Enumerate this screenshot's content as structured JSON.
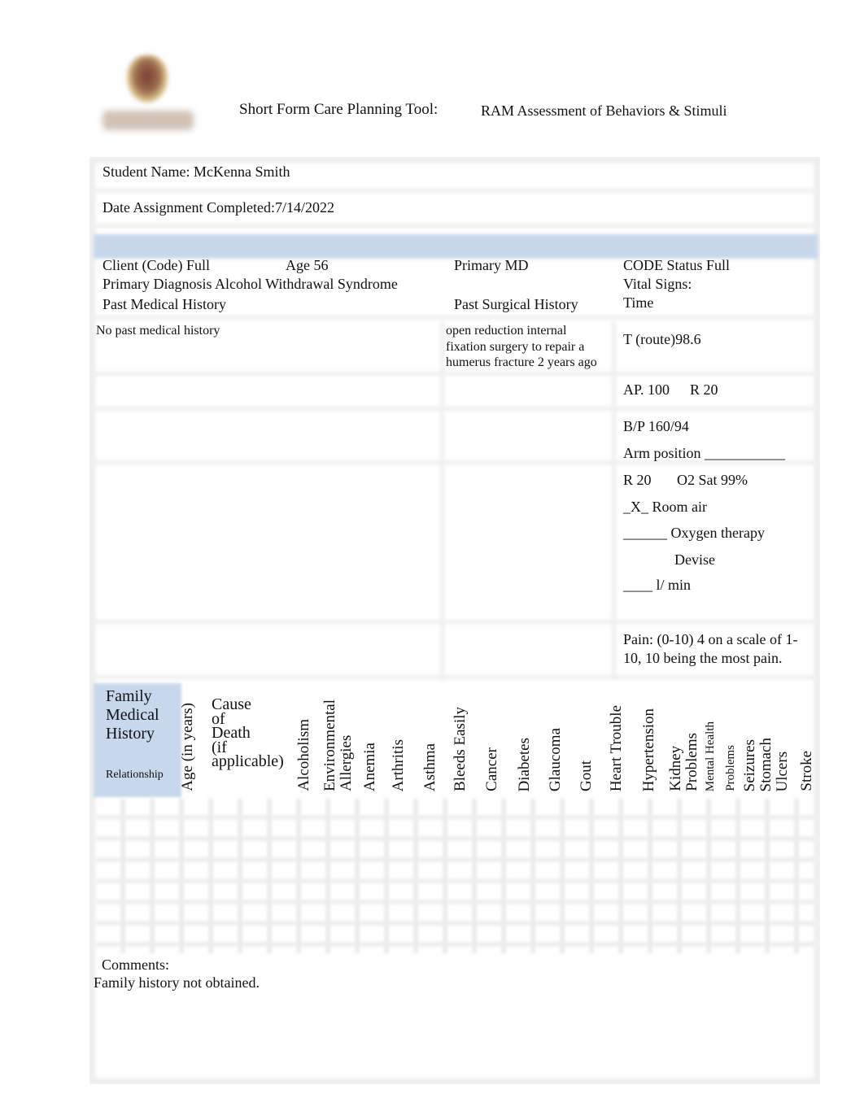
{
  "header": {
    "logo_icon": "school-crest-logo",
    "title": "Short Form Care Planning Tool:",
    "subtitle": "RAM Assessment of Behaviors & Stimuli"
  },
  "student": {
    "name_label": "Student Name: McKenna Smith",
    "date_label": "Date Assignment Completed:7/14/2022"
  },
  "client": {
    "code": "Client  (Code)  Full",
    "age": "Age 56",
    "primary_md": "Primary MD",
    "code_status": "CODE Status Full",
    "primary_diagnosis": "Primary Diagnosis Alcohol Withdrawal Syndrome",
    "vital_signs_label": "Vital Signs:",
    "past_medical_history_label": "Past Medical History",
    "past_surgical_history_label": "Past Surgical History",
    "time_label": "Time",
    "past_medical_history_value": "No past medical history",
    "past_surgical_history_lines": [
      "open reduction internal",
      "fixation surgery to repair a",
      "humerus fracture 2 years ago"
    ]
  },
  "vitals": {
    "temperature": "T (route)98.6",
    "apical_pulse": "AP. 100",
    "resp_1": "R 20",
    "bp": "B/P 160/94",
    "arm_position": "Arm position ___________",
    "resp_2": "R 20",
    "o2_sat": "O2 Sat 99%",
    "room_air": "_X_ Room air",
    "oxygen_therapy": "______ Oxygen therapy",
    "device": "Devise",
    "flow_rate": "____ l/ min",
    "pain_line1": "Pain: (0-10) 4 on a scale of 1-",
    "pain_line2": "10, 10 being the most pain."
  },
  "family_history": {
    "title_lines": [
      "Family",
      "Medical",
      "History"
    ],
    "relationship_label": "Relationship",
    "age_header": "Age (in years)",
    "cause_of_death_lines": [
      "Cause",
      "of",
      "Death",
      "(if",
      "applicable)"
    ],
    "conditions": [
      "Alcoholism",
      "Environmental Allergies",
      "Anemia",
      "Arthritis",
      "Asthma",
      "Bleeds Easily",
      "Cancer",
      "Diabetes",
      "Glaucoma",
      "Gout",
      "Heart Trouble",
      "Hypertension",
      "Kidney Problems",
      "Mental Health Problems",
      "Seizures",
      "Stomach Ulcers",
      "Stroke"
    ],
    "env_allergies_lines": [
      "Environmental",
      "Allergies"
    ],
    "kidney_lines": [
      "Kidney",
      "Problems"
    ],
    "mental_health_lines": [
      "Mental Health",
      "Problems"
    ],
    "stomach_lines": [
      "Stomach",
      "Ulcers"
    ]
  },
  "comments": {
    "label": "Comments:",
    "text": "Family history not obtained."
  }
}
